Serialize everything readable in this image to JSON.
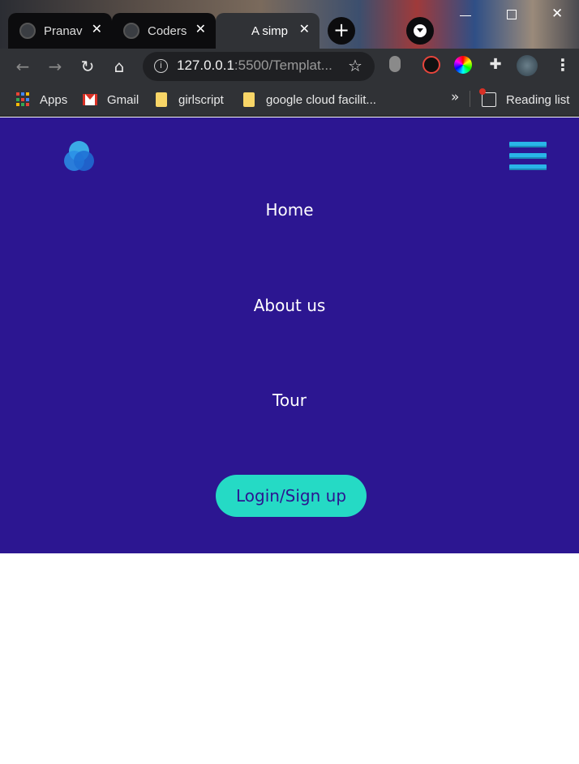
{
  "browser": {
    "tabs": [
      {
        "title": "Pranav",
        "close": "✕"
      },
      {
        "title": "Coders",
        "close": "✕"
      },
      {
        "title": "A simp",
        "close": "✕"
      }
    ],
    "new_tab": "+",
    "address": {
      "host": "127.0.0.1",
      "path": ":5500/Templat..."
    },
    "bookmarks": [
      {
        "label": "Apps",
        "icon": "apps-grid-icon"
      },
      {
        "label": "Gmail",
        "icon": "gmail-icon"
      },
      {
        "label": "girlscript",
        "icon": "folder-icon"
      },
      {
        "label": "google cloud facilit...",
        "icon": "folder-icon"
      }
    ],
    "more_bookmarks": "»",
    "reading_list": "Reading list",
    "icons": {
      "back": "←",
      "forward": "→",
      "reload": "↻",
      "home": "⌂",
      "star": "☆",
      "menu": "⋮",
      "info": "i"
    }
  },
  "page": {
    "brand_colors": {
      "background": "#2c1691",
      "accent": "#25dac5",
      "hamburger": "#29b5e8"
    },
    "nav": [
      {
        "label": "Home"
      },
      {
        "label": "About us"
      },
      {
        "label": "Tour"
      }
    ],
    "login_button": "Login/Sign up"
  }
}
